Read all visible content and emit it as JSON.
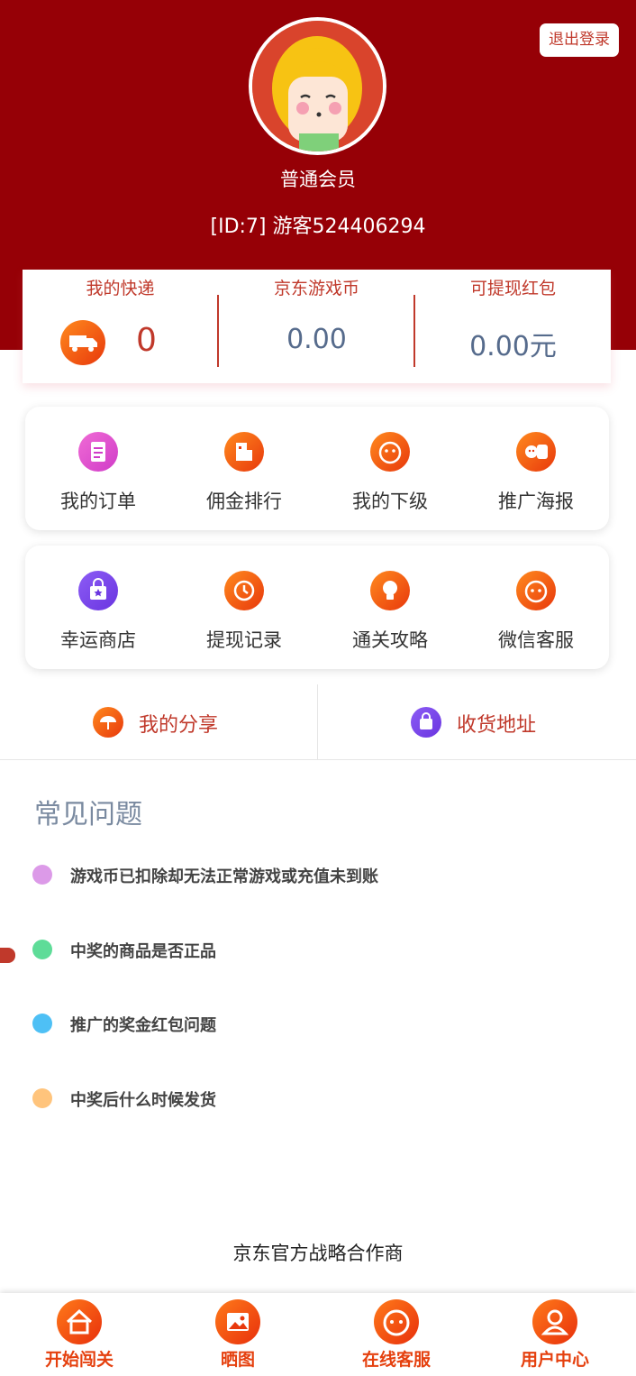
{
  "header": {
    "logout_label": "退出登录",
    "member_level": "普通会员",
    "user_id_text": "[ID:7] 游客524406294"
  },
  "stats": [
    {
      "label": "我的快递",
      "value": "0"
    },
    {
      "label": "京东游戏币",
      "value": "0.00"
    },
    {
      "label": "可提现红包",
      "value": "0.00元"
    }
  ],
  "menu_row1": [
    {
      "label": "我的订单",
      "icon": "order-icon"
    },
    {
      "label": "佣金排行",
      "icon": "ranking-icon"
    },
    {
      "label": "我的下级",
      "icon": "subordinate-icon"
    },
    {
      "label": "推广海报",
      "icon": "poster-icon"
    }
  ],
  "menu_row2": [
    {
      "label": "幸运商店",
      "icon": "store-icon"
    },
    {
      "label": "提现记录",
      "icon": "withdraw-history-icon"
    },
    {
      "label": "通关攻略",
      "icon": "guide-icon"
    },
    {
      "label": "微信客服",
      "icon": "wechat-service-icon"
    }
  ],
  "share": [
    {
      "label": "我的分享",
      "icon": "share-umbrella-icon"
    },
    {
      "label": "收货地址",
      "icon": "address-bag-icon"
    }
  ],
  "faq": {
    "title": "常见问题",
    "items": [
      {
        "text": "游戏币已扣除却无法正常游戏或充值未到账",
        "color": "#dc9ae8"
      },
      {
        "text": "中奖的商品是否正品",
        "color": "#5edc98"
      },
      {
        "text": "推广的奖金红包问题",
        "color": "#4ec0f5"
      },
      {
        "text": "中奖后什么时候发货",
        "color": "#ffc47c"
      }
    ]
  },
  "partner_text": "京东官方战略合作商",
  "tabbar": [
    {
      "label": "开始闯关",
      "icon": "home-icon"
    },
    {
      "label": "晒图",
      "icon": "photo-icon"
    },
    {
      "label": "在线客服",
      "icon": "customer-service-icon"
    },
    {
      "label": "用户中心",
      "icon": "user-icon"
    }
  ],
  "colors": {
    "header_bg": "#960006",
    "accent_red": "#c0392b",
    "tab_orange": "#e5400e"
  }
}
